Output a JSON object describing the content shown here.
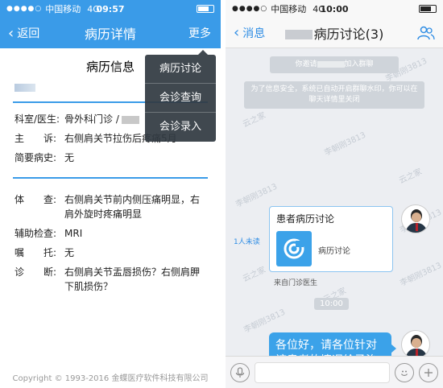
{
  "left": {
    "status": {
      "signal": "●●●●○",
      "carrier": "中国移动",
      "network": "4G",
      "time": "09:57"
    },
    "nav": {
      "back_label": "返回",
      "title": "病历详情",
      "more_label": "更多"
    },
    "dropdown": {
      "items": [
        "病历讨论",
        "会诊查询",
        "会诊录入"
      ]
    },
    "section_title": "病历信息",
    "fields": [
      {
        "label": "科室/医生:",
        "value": "骨外科门诊 /"
      },
      {
        "label": "主　　诉:",
        "value": "右侧肩关节拉伤后疼痛5月"
      },
      {
        "label": "简要病史:",
        "value": "无"
      }
    ],
    "exam_fields": [
      {
        "label": "体　　查:",
        "value": "右侧肩关节前内侧压痛明显，右肩外旋时疼痛明显"
      },
      {
        "label": "辅助检查:",
        "value": "MRI"
      },
      {
        "label": "嘱　　托:",
        "value": "无"
      },
      {
        "label": "诊　　断:",
        "value": "右侧肩关节盂唇损伤？右侧肩胛下肌损伤？"
      }
    ],
    "copyright": "Copyright © 1993-2016 金蝶医疗软件科技有限公司"
  },
  "right": {
    "status": {
      "signal": "●●●●○",
      "carrier": "中国移动",
      "network": "4G",
      "time": "10:00"
    },
    "nav": {
      "back_label": "消息",
      "title": "病历讨论(3)"
    },
    "watermark": [
      "李朝刚3813",
      "云之家"
    ],
    "sys_messages": [
      {
        "prefix": "你邀请",
        "suffix": "加入群聊"
      },
      {
        "text": "为了信息安全，系统已自动开启群聊水印，你可以在聊天详情里关闭"
      }
    ],
    "card": {
      "title": "患者病历讨论",
      "subtitle": "病历讨论",
      "read_status": "1人未读",
      "from": "来自门诊医生"
    },
    "time_divider": "10:00",
    "message": "各位好，请各位针对该患者的情况给予治疗建议，谢谢!",
    "colors": {
      "accent": "#3ba2e9",
      "nav_blue": "#3a9be8"
    },
    "input_icons": [
      "microphone-icon",
      "emoji-icon",
      "plus-icon"
    ]
  }
}
